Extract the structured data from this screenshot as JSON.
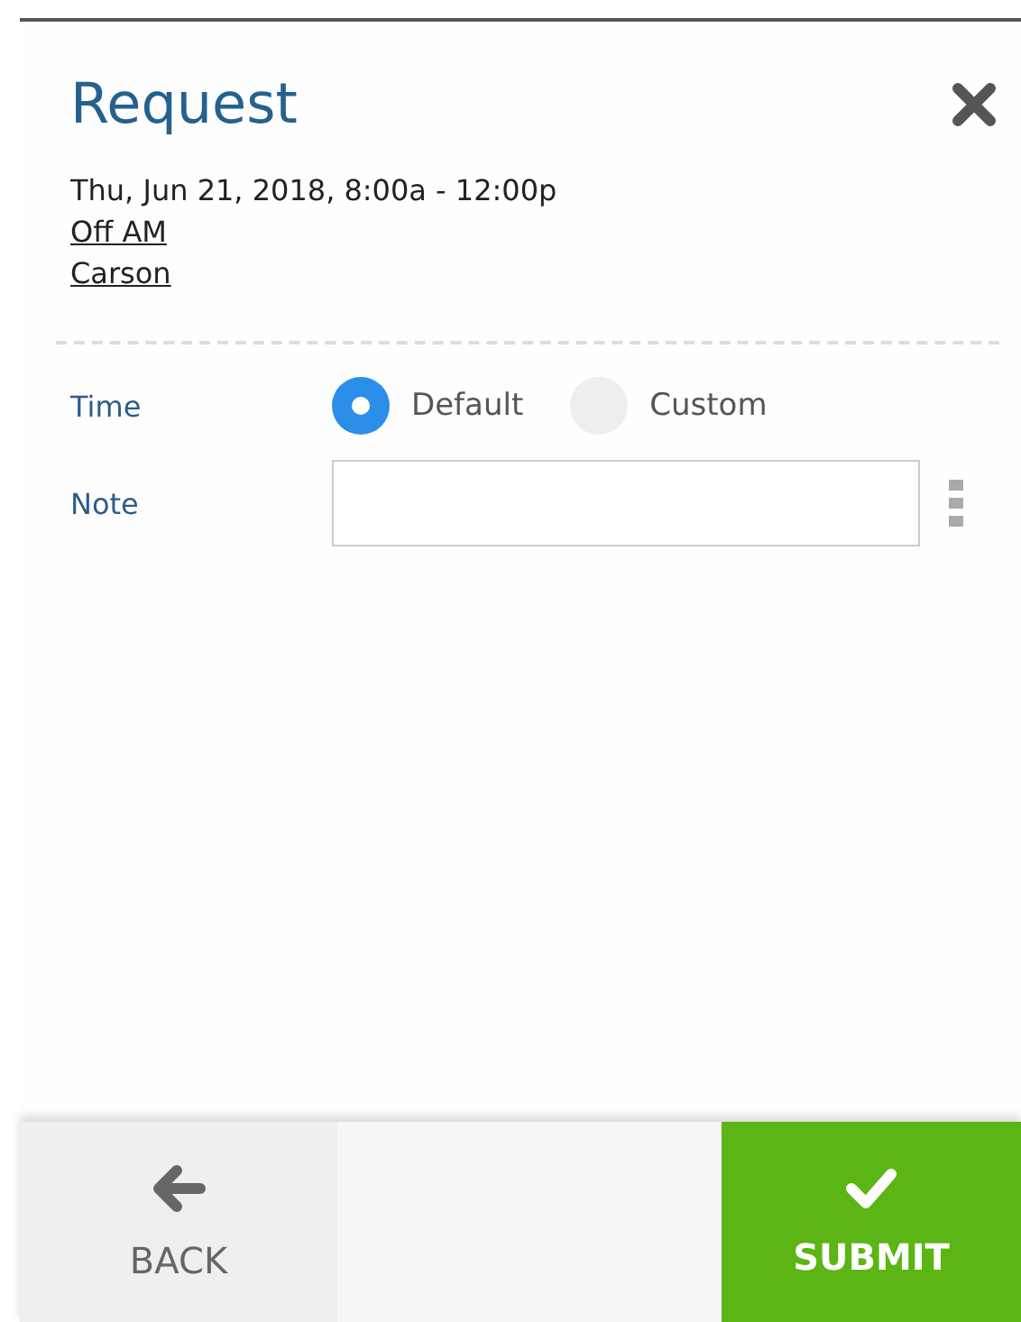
{
  "title": "Request",
  "details": {
    "datetime": "Thu, Jun 21, 2018, 8:00a - 12:00p",
    "links": [
      "Off AM",
      "Carson"
    ]
  },
  "time": {
    "label": "Time",
    "options": [
      {
        "label": "Default",
        "selected": true
      },
      {
        "label": "Custom",
        "selected": false
      }
    ]
  },
  "note": {
    "label": "Note"
  },
  "footer": {
    "back": "BACK",
    "submit": "SUBMIT"
  }
}
